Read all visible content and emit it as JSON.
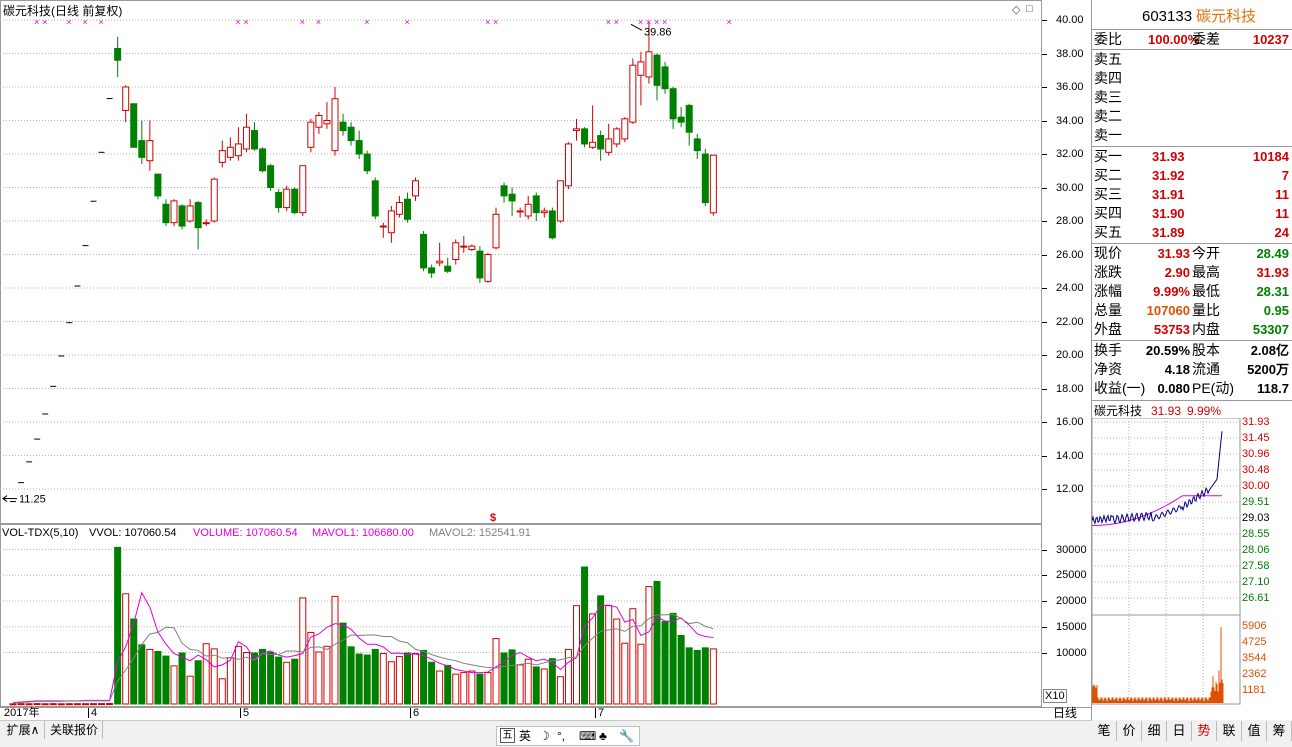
{
  "title": "碳元科技(日线 前复权)",
  "colors": {
    "up": "#d40000",
    "down": "#008000",
    "grid": "#b0b0b0",
    "magenta": "#e000e0",
    "navy": "#000080",
    "orange": "#e05000",
    "gray": "#808080"
  },
  "price_axis": {
    "ticks": [
      "40.00",
      "38.00",
      "36.00",
      "34.00",
      "32.00",
      "30.00",
      "28.00",
      "26.00",
      "24.00",
      "22.00",
      "20.00",
      "18.00",
      "16.00",
      "14.00",
      "12.00"
    ],
    "high_label": "39.86",
    "low_label": "11.25"
  },
  "vol_axis": {
    "ticks": [
      "30000",
      "25000",
      "20000",
      "15000",
      "10000"
    ],
    "multiplier": "X10"
  },
  "vol_header": {
    "name": "VOL-TDX(5,10)",
    "vvol": "VVOL: 107060.54",
    "volume": "VOLUME: 107060.54",
    "mavol1": "MAVOL1: 106680.00",
    "mavol2": "MAVOL2: 152541.91"
  },
  "date_axis": {
    "year": "2017年",
    "months": [
      "4",
      "5",
      "6",
      "7"
    ],
    "period": "日线"
  },
  "bottom_tabs": [
    "扩展∧",
    "关联报价"
  ],
  "ime": {
    "lang": "英"
  },
  "quote": {
    "code": "603133",
    "name": "碳元科技",
    "weibi_label": "委比",
    "weibi": "100.00%",
    "weicha_label": "委差",
    "weicha": "10237",
    "sells": [
      {
        "label": "卖五"
      },
      {
        "label": "卖四"
      },
      {
        "label": "卖三"
      },
      {
        "label": "卖二"
      },
      {
        "label": "卖一"
      }
    ],
    "buys": [
      {
        "label": "买一",
        "price": "31.93",
        "vol": "10184"
      },
      {
        "label": "买二",
        "price": "31.92",
        "vol": "7"
      },
      {
        "label": "买三",
        "price": "31.91",
        "vol": "11"
      },
      {
        "label": "买四",
        "price": "31.90",
        "vol": "11"
      },
      {
        "label": "买五",
        "price": "31.89",
        "vol": "24"
      }
    ],
    "stats": [
      {
        "l1": "现价",
        "v1": "31.93",
        "l2": "今开",
        "v2": "28.49"
      },
      {
        "l1": "涨跌",
        "v1": "2.90",
        "l2": "最高",
        "v2": "31.93"
      },
      {
        "l1": "涨幅",
        "v1": "9.99%",
        "l2": "最低",
        "v2": "28.31"
      },
      {
        "l1": "总量",
        "v1": "107060",
        "l2": "量比",
        "v2": "0.95"
      },
      {
        "l1": "外盘",
        "v1": "53753",
        "l2": "内盘",
        "v2": "53307"
      }
    ],
    "fin": [
      {
        "l1": "换手",
        "v1": "20.59%",
        "l2": "股本",
        "v2": "2.08亿"
      },
      {
        "l1": "净资",
        "v1": "4.18",
        "l2": "流通",
        "v2": "5200万"
      },
      {
        "l1": "收益(一)",
        "v1": "0.080",
        "l2": "PE(动)",
        "v2": "118.7"
      }
    ]
  },
  "mini": {
    "title": "碳元科技",
    "price": "31.93",
    "pct": "9.99%",
    "price_ticks": [
      "31.93",
      "31.45",
      "30.96",
      "30.48",
      "30.00",
      "29.51",
      "29.03",
      "28.55",
      "28.06",
      "27.58",
      "27.10",
      "26.61"
    ],
    "vol_ticks": [
      "5906",
      "4725",
      "3544",
      "2362",
      "1181"
    ]
  },
  "right_tabs": [
    "笔",
    "价",
    "细",
    "日",
    "势",
    "联",
    "值",
    "筹"
  ],
  "candles": [
    {
      "o": 11.25,
      "c": 11.25,
      "h": 11.25,
      "l": 11.25
    },
    {
      "o": 12.38,
      "c": 12.38,
      "h": 12.38,
      "l": 12.38
    },
    {
      "o": 13.62,
      "c": 13.62,
      "h": 13.62,
      "l": 13.62
    },
    {
      "o": 14.98,
      "c": 14.98,
      "h": 14.98,
      "l": 14.98
    },
    {
      "o": 16.48,
      "c": 16.48,
      "h": 16.48,
      "l": 16.48
    },
    {
      "o": 18.13,
      "c": 18.13,
      "h": 18.13,
      "l": 18.13
    },
    {
      "o": 19.94,
      "c": 19.94,
      "h": 19.94,
      "l": 19.94
    },
    {
      "o": 21.93,
      "c": 21.93,
      "h": 21.93,
      "l": 21.93
    },
    {
      "o": 24.12,
      "c": 24.12,
      "h": 24.12,
      "l": 24.12
    },
    {
      "o": 26.53,
      "c": 26.53,
      "h": 26.53,
      "l": 26.53
    },
    {
      "o": 29.18,
      "c": 29.18,
      "h": 29.18,
      "l": 29.18
    },
    {
      "o": 32.1,
      "c": 32.1,
      "h": 32.1,
      "l": 32.1
    },
    {
      "o": 35.31,
      "c": 35.31,
      "h": 35.31,
      "l": 35.31
    },
    {
      "o": 38.3,
      "c": 37.6,
      "h": 39.0,
      "l": 36.6
    },
    {
      "o": 34.6,
      "c": 36.0,
      "h": 36.1,
      "l": 33.9
    },
    {
      "o": 35.0,
      "c": 32.4,
      "h": 35.0,
      "l": 32.4
    },
    {
      "o": 32.8,
      "c": 31.8,
      "h": 34.0,
      "l": 31.4
    },
    {
      "o": 31.6,
      "c": 32.8,
      "h": 34.0,
      "l": 31.0
    },
    {
      "o": 30.8,
      "c": 29.5,
      "h": 30.8,
      "l": 29.3
    },
    {
      "o": 29.0,
      "c": 27.9,
      "h": 29.3,
      "l": 27.7
    },
    {
      "o": 27.9,
      "c": 29.2,
      "h": 29.3,
      "l": 27.7
    },
    {
      "o": 28.9,
      "c": 27.7,
      "h": 29.0,
      "l": 27.5
    },
    {
      "o": 28.0,
      "c": 28.9,
      "h": 29.3,
      "l": 27.9
    },
    {
      "o": 29.1,
      "c": 27.6,
      "h": 29.2,
      "l": 26.3
    },
    {
      "o": 27.9,
      "c": 27.9,
      "h": 28.1,
      "l": 27.7
    },
    {
      "o": 28.0,
      "c": 30.5,
      "h": 30.6,
      "l": 27.9
    },
    {
      "o": 31.5,
      "c": 32.2,
      "h": 32.8,
      "l": 31.2
    },
    {
      "o": 31.8,
      "c": 32.4,
      "h": 33.0,
      "l": 31.6
    },
    {
      "o": 31.9,
      "c": 32.6,
      "h": 33.6,
      "l": 31.6
    },
    {
      "o": 32.3,
      "c": 33.6,
      "h": 34.4,
      "l": 32.1
    },
    {
      "o": 33.4,
      "c": 32.3,
      "h": 33.9,
      "l": 32.2
    },
    {
      "o": 32.3,
      "c": 31.0,
      "h": 32.4,
      "l": 30.9
    },
    {
      "o": 31.3,
      "c": 30.0,
      "h": 31.4,
      "l": 29.8
    },
    {
      "o": 29.7,
      "c": 28.8,
      "h": 29.9,
      "l": 28.5
    },
    {
      "o": 28.8,
      "c": 29.9,
      "h": 30.1,
      "l": 28.6
    },
    {
      "o": 29.9,
      "c": 28.5,
      "h": 30.0,
      "l": 28.4
    },
    {
      "o": 28.5,
      "c": 31.3,
      "h": 31.3,
      "l": 28.3
    },
    {
      "o": 32.4,
      "c": 33.9,
      "h": 34.1,
      "l": 32.1
    },
    {
      "o": 33.6,
      "c": 34.3,
      "h": 34.5,
      "l": 33.2
    },
    {
      "o": 33.8,
      "c": 34.0,
      "h": 35.1,
      "l": 33.5
    },
    {
      "o": 32.2,
      "c": 35.3,
      "h": 36.0,
      "l": 31.9
    },
    {
      "o": 33.9,
      "c": 33.4,
      "h": 34.4,
      "l": 33.1
    },
    {
      "o": 33.6,
      "c": 32.8,
      "h": 33.9,
      "l": 32.5
    },
    {
      "o": 32.8,
      "c": 32.0,
      "h": 33.4,
      "l": 31.7
    },
    {
      "o": 32.0,
      "c": 31.0,
      "h": 32.2,
      "l": 30.8
    },
    {
      "o": 30.4,
      "c": 28.3,
      "h": 30.6,
      "l": 28.1
    },
    {
      "o": 27.7,
      "c": 27.7,
      "h": 27.9,
      "l": 27.0
    },
    {
      "o": 27.3,
      "c": 28.6,
      "h": 28.9,
      "l": 26.7
    },
    {
      "o": 28.4,
      "c": 29.1,
      "h": 29.5,
      "l": 28.2
    },
    {
      "o": 29.3,
      "c": 28.1,
      "h": 29.7,
      "l": 27.9
    },
    {
      "o": 29.5,
      "c": 30.4,
      "h": 30.6,
      "l": 29.2
    },
    {
      "o": 27.2,
      "c": 25.2,
      "h": 27.4,
      "l": 25.0
    },
    {
      "o": 25.2,
      "c": 24.9,
      "h": 25.4,
      "l": 24.6
    },
    {
      "o": 25.5,
      "c": 25.6,
      "h": 26.7,
      "l": 25.3
    },
    {
      "o": 25.3,
      "c": 25.0,
      "h": 25.8,
      "l": 24.9
    },
    {
      "o": 25.7,
      "c": 26.7,
      "h": 26.9,
      "l": 25.4
    },
    {
      "o": 26.5,
      "c": 26.5,
      "h": 27.1,
      "l": 26.1
    },
    {
      "o": 26.3,
      "c": 26.5,
      "h": 26.6,
      "l": 26.2
    },
    {
      "o": 26.2,
      "c": 24.6,
      "h": 26.5,
      "l": 24.3
    },
    {
      "o": 24.4,
      "c": 26.0,
      "h": 26.1,
      "l": 24.3
    },
    {
      "o": 26.4,
      "c": 28.4,
      "h": 28.8,
      "l": 26.3
    },
    {
      "o": 30.1,
      "c": 29.5,
      "h": 30.3,
      "l": 29.1
    },
    {
      "o": 29.6,
      "c": 29.2,
      "h": 30.0,
      "l": 28.3
    },
    {
      "o": 28.6,
      "c": 28.6,
      "h": 28.8,
      "l": 28.2
    },
    {
      "o": 28.3,
      "c": 29.0,
      "h": 29.5,
      "l": 28.1
    },
    {
      "o": 29.5,
      "c": 28.5,
      "h": 29.7,
      "l": 28.0
    },
    {
      "o": 28.5,
      "c": 28.6,
      "h": 28.8,
      "l": 28.2
    },
    {
      "o": 28.6,
      "c": 27.0,
      "h": 28.8,
      "l": 26.9
    },
    {
      "o": 28.0,
      "c": 30.4,
      "h": 30.4,
      "l": 27.9
    },
    {
      "o": 30.1,
      "c": 32.6,
      "h": 32.7,
      "l": 29.9
    },
    {
      "o": 33.4,
      "c": 33.5,
      "h": 34.1,
      "l": 32.8
    },
    {
      "o": 33.5,
      "c": 32.6,
      "h": 33.6,
      "l": 32.4
    },
    {
      "o": 32.4,
      "c": 32.7,
      "h": 34.9,
      "l": 32.3
    },
    {
      "o": 33.1,
      "c": 32.3,
      "h": 33.4,
      "l": 31.6
    },
    {
      "o": 32.1,
      "c": 32.9,
      "h": 33.8,
      "l": 31.9
    },
    {
      "o": 32.6,
      "c": 33.5,
      "h": 33.6,
      "l": 32.4
    },
    {
      "o": 32.9,
      "c": 34.1,
      "h": 34.2,
      "l": 32.7
    },
    {
      "o": 33.9,
      "c": 37.3,
      "h": 37.7,
      "l": 33.8
    },
    {
      "o": 36.7,
      "c": 37.5,
      "h": 38.1,
      "l": 34.9
    },
    {
      "o": 36.6,
      "c": 38.1,
      "h": 39.86,
      "l": 36.2
    },
    {
      "o": 37.9,
      "c": 36.1,
      "h": 38.0,
      "l": 35.2
    },
    {
      "o": 37.2,
      "c": 35.9,
      "h": 37.5,
      "l": 35.6
    },
    {
      "o": 35.9,
      "c": 34.1,
      "h": 36.0,
      "l": 33.5
    },
    {
      "o": 34.2,
      "c": 33.9,
      "h": 34.8,
      "l": 33.6
    },
    {
      "o": 34.9,
      "c": 33.3,
      "h": 35.0,
      "l": 32.5
    },
    {
      "o": 32.9,
      "c": 32.2,
      "h": 33.2,
      "l": 31.7
    },
    {
      "o": 32.0,
      "c": 29.1,
      "h": 32.3,
      "l": 28.9
    },
    {
      "o": 28.49,
      "c": 31.93,
      "h": 31.93,
      "l": 28.31
    }
  ],
  "volumes": [
    35,
    70,
    50,
    80,
    50,
    70,
    40,
    60,
    60,
    60,
    70,
    80,
    90,
    30414,
    21400,
    16500,
    11500,
    10600,
    10200,
    9300,
    7400,
    9900,
    5400,
    8400,
    11700,
    10700,
    4900,
    9000,
    11200,
    10000,
    9900,
    10600,
    10000,
    9100,
    8100,
    8700,
    20600,
    13900,
    10100,
    11200,
    20900,
    15700,
    11100,
    9700,
    9500,
    10600,
    9800,
    8200,
    9200,
    9900,
    9800,
    10400,
    8100,
    6400,
    7500,
    5800,
    6100,
    6400,
    5800,
    6100,
    12700,
    9900,
    10500,
    7600,
    8700,
    7200,
    6800,
    8800,
    5300,
    10600,
    19100,
    26600,
    17500,
    21000,
    19100,
    16500,
    11800,
    18500,
    11600,
    22800,
    23800,
    16000,
    17600,
    13300,
    10900,
    10400,
    10900,
    10700
  ],
  "ma5": [
    0.3,
    0.4,
    0.5,
    0.6,
    0.6,
    0.6,
    0.6,
    0.6,
    0.6,
    0.7,
    0.7,
    0.7,
    0.7,
    8.2,
    11.1,
    15.7,
    21.6,
    18.8,
    14.0,
    11.6,
    9.8,
    9.1,
    8.4,
    9.5,
    8.6,
    7.2,
    7.6,
    8.5,
    12.1,
    11.1,
    8.8,
    9.9,
    10.3,
    9.5,
    9.1,
    9.4,
    9.8,
    13.0,
    13.6,
    14.9,
    15.6,
    15.4,
    14.5,
    12.8,
    11.6,
    11.6,
    11.1,
    9.8,
    9.9,
    9.6,
    9.7,
    9.4,
    8.7,
    7.9,
    7.4,
    6.7,
    6.4,
    6.1,
    6.1,
    6.2,
    7.2,
    8.2,
    9.4,
    10.0,
    9.1,
    8.4,
    8.7,
    8.0,
    6.7,
    8.1,
    9.0,
    15.1,
    16.7,
    19.1,
    19.2,
    18.8,
    15.9,
    16.4,
    13.3,
    14.0,
    16.9,
    16.1,
    16.1,
    16.7,
    15.3,
    13.6,
    13.1,
    12.9
  ],
  "ma10": [
    0.2,
    0.3,
    0.4,
    0.5,
    0.5,
    0.5,
    0.5,
    0.6,
    0.6,
    0.6,
    0.6,
    0.6,
    0.6,
    4.5,
    6.6,
    8.9,
    11.6,
    13.6,
    13.9,
    14.9,
    14.8,
    11.8,
    10.6,
    10.4,
    9.3,
    9.5,
    8.9,
    9.0,
    8.7,
    9.1,
    8.5,
    9.8,
    9.6,
    9.6,
    10.3,
    10.3,
    10.1,
    11.0,
    11.1,
    10.6,
    11.6,
    12.4,
    13.4,
    13.3,
    13.4,
    13.4,
    13.1,
    13.1,
    12.2,
    11.9,
    10.6,
    10.2,
    9.6,
    9.1,
    8.7,
    8.4,
    7.9,
    7.6,
    7.3,
    7.1,
    7.0,
    7.3,
    7.5,
    7.7,
    7.9,
    7.6,
    8.0,
    8.4,
    8.6,
    9.0,
    9.1,
    11.3,
    12.8,
    14.1,
    14.4,
    14.6,
    14.1,
    15.1,
    15.2,
    16.6,
    17.3,
    17.3,
    17.4,
    16.6,
    15.6,
    15.9,
    15.1,
    14.6
  ]
}
